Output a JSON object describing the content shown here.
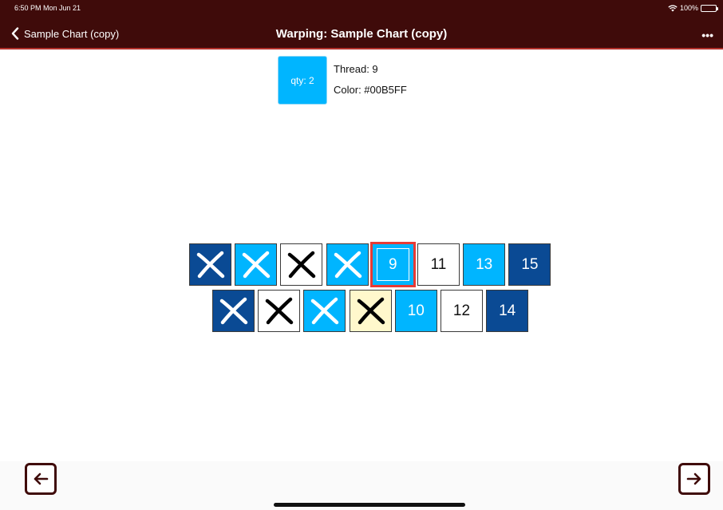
{
  "status_bar": {
    "time": "6:50 PM  Mon Jun 21",
    "battery": "100%",
    "wifi_icon": "wifi-icon",
    "battery_icon": "battery-icon"
  },
  "nav": {
    "back_label": "Sample Chart (copy)",
    "title": "Warping: Sample Chart (copy)",
    "more_label": "•••"
  },
  "current": {
    "qty_label": "qty: 2",
    "thread_label": "Thread:  9",
    "color_label": "Color:  #00B5FF",
    "color": "#00B5FF"
  },
  "colors": {
    "navy": "#0a4a94",
    "sky": "#00b5ff",
    "white": "#ffffff",
    "cream": "#fff8cc",
    "nav_bg": "#3f0b0a",
    "selection": "#e83b35"
  },
  "grid": {
    "row1": [
      {
        "label": "",
        "fill": "navy",
        "crossed": true,
        "mark": "white"
      },
      {
        "label": "",
        "fill": "sky",
        "crossed": true,
        "mark": "white"
      },
      {
        "label": "",
        "fill": "white",
        "crossed": true,
        "mark": "black"
      },
      {
        "label": "",
        "fill": "sky",
        "crossed": true,
        "mark": "white"
      },
      {
        "label": "9",
        "fill": "sky",
        "crossed": false,
        "selected": true
      },
      {
        "label": "11",
        "fill": "white",
        "crossed": false
      },
      {
        "label": "13",
        "fill": "sky",
        "crossed": false
      },
      {
        "label": "15",
        "fill": "navy",
        "crossed": false
      }
    ],
    "row2": [
      {
        "label": "",
        "fill": "navy",
        "crossed": true,
        "mark": "white"
      },
      {
        "label": "",
        "fill": "white",
        "crossed": true,
        "mark": "black"
      },
      {
        "label": "",
        "fill": "sky",
        "crossed": true,
        "mark": "white"
      },
      {
        "label": "",
        "fill": "cream",
        "crossed": true,
        "mark": "black"
      },
      {
        "label": "10",
        "fill": "sky",
        "crossed": false
      },
      {
        "label": "12",
        "fill": "white",
        "crossed": false
      },
      {
        "label": "14",
        "fill": "navy",
        "crossed": false
      }
    ]
  },
  "footer": {
    "prev_icon": "arrow-left-icon",
    "next_icon": "arrow-right-icon"
  }
}
